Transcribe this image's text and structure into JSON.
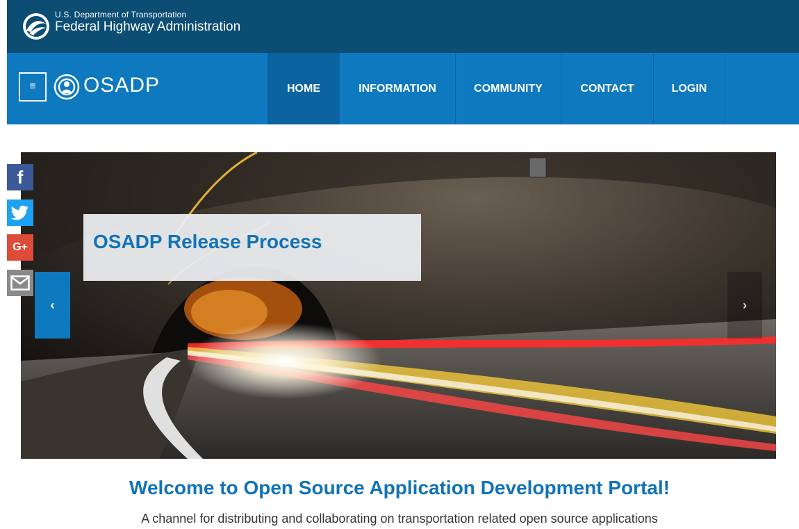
{
  "agency": {
    "subtitle": "U.S. Department of Transportation",
    "name": "Federal Highway Administration"
  },
  "header": {
    "menu_glyph": "≡",
    "logo_text": "OSADP"
  },
  "nav": {
    "items": [
      {
        "label": "HOME",
        "active": true
      },
      {
        "label": "INFORMATION",
        "active": false
      },
      {
        "label": "COMMUNITY",
        "active": false
      },
      {
        "label": "CONTACT",
        "active": false
      },
      {
        "label": "LOGIN",
        "active": false
      }
    ]
  },
  "carousel": {
    "caption": "OSADP Release Process",
    "prev_glyph": "‹",
    "next_glyph": "›"
  },
  "social": {
    "facebook_glyph": "f",
    "googleplus_glyph": "G+"
  },
  "welcome": {
    "title": "Welcome to Open Source Application Development Portal!",
    "subtitle": "A channel for distributing and collaborating on transportation related open source applications"
  },
  "colors": {
    "agency_bar": "#0b4d73",
    "nav_bar": "#0e79bf",
    "nav_active": "#0b63a0",
    "accent_text": "#1273b7"
  }
}
